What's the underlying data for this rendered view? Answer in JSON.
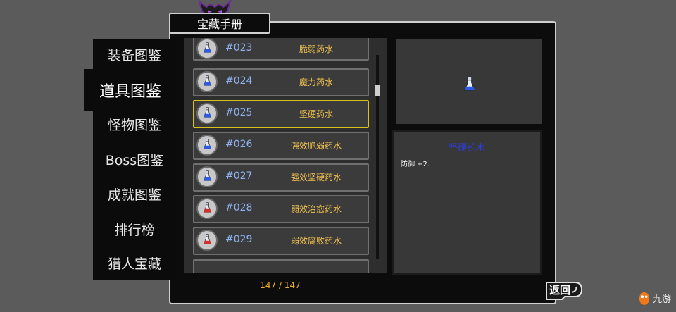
{
  "title": "宝藏手册",
  "tabs": [
    {
      "label": "装备图鉴",
      "active": false
    },
    {
      "label": "道具图鉴",
      "active": true
    },
    {
      "label": "怪物图鉴",
      "active": false
    },
    {
      "label": "Boss图鉴",
      "active": false
    },
    {
      "label": "成就图鉴",
      "active": false
    },
    {
      "label": "排行榜",
      "active": false
    },
    {
      "label": "猎人宝藏",
      "active": false
    }
  ],
  "items": [
    {
      "num": "#023",
      "name": "脆弱药水",
      "color": "#2d5ae0"
    },
    {
      "num": "#024",
      "name": "魔力药水",
      "color": "#2d5ae0"
    },
    {
      "num": "#025",
      "name": "坚硬药水",
      "color": "#2d5ae0",
      "selected": true
    },
    {
      "num": "#026",
      "name": "强效脆弱药水",
      "color": "#2d5ae0"
    },
    {
      "num": "#027",
      "name": "强效坚硬药水",
      "color": "#2d5ae0"
    },
    {
      "num": "#028",
      "name": "弱效治愈药水",
      "color": "#d03030"
    },
    {
      "num": "#029",
      "name": "弱效腐败药水",
      "color": "#d03030"
    }
  ],
  "detail": {
    "name": "坚硬药水",
    "desc": "防御 +2."
  },
  "count": "147 / 147",
  "back_label": "返回",
  "watermark": "九游"
}
